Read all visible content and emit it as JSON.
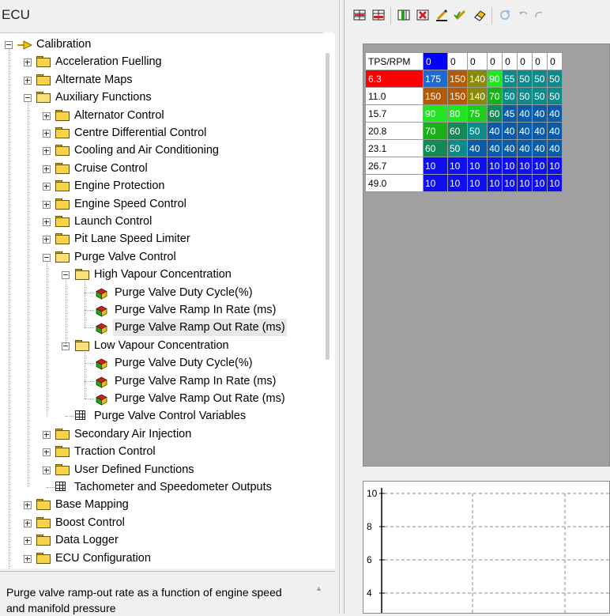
{
  "left_panel": {
    "title": "ECU",
    "tree": [
      {
        "label": "Calibration",
        "icon": "calibration-icon",
        "expander": "minus"
      },
      {
        "label": "Acceleration Fuelling",
        "icon": "folder-icon",
        "expander": "plus"
      },
      {
        "label": "Alternate Maps",
        "icon": "folder-icon",
        "expander": "plus"
      },
      {
        "label": "Auxiliary Functions",
        "icon": "folder-open-icon",
        "expander": "minus"
      },
      {
        "label": "Alternator Control",
        "icon": "folder-icon",
        "expander": "plus"
      },
      {
        "label": "Centre Differential Control",
        "icon": "folder-icon",
        "expander": "plus"
      },
      {
        "label": "Cooling and Air Conditioning",
        "icon": "folder-icon",
        "expander": "plus"
      },
      {
        "label": "Cruise Control",
        "icon": "folder-icon",
        "expander": "plus"
      },
      {
        "label": "Engine Protection",
        "icon": "folder-icon",
        "expander": "plus"
      },
      {
        "label": "Engine Speed Control",
        "icon": "folder-icon",
        "expander": "plus"
      },
      {
        "label": "Launch Control",
        "icon": "folder-icon",
        "expander": "plus"
      },
      {
        "label": "Pit Lane Speed Limiter",
        "icon": "folder-icon",
        "expander": "plus"
      },
      {
        "label": "Purge Valve Control",
        "icon": "folder-open-icon",
        "expander": "minus"
      },
      {
        "label": "High Vapour Concentration",
        "icon": "folder-open-icon",
        "expander": "minus"
      },
      {
        "label": "Purge Valve Duty Cycle(%)",
        "icon": "map-cube-icon"
      },
      {
        "label": "Purge Valve Ramp In Rate (ms)",
        "icon": "map-cube-icon"
      },
      {
        "label": "Purge Valve Ramp Out Rate (ms)",
        "icon": "map-cube-icon",
        "selected": true
      },
      {
        "label": "Low Vapour Concentration",
        "icon": "folder-open-icon",
        "expander": "minus"
      },
      {
        "label": "Purge Valve Duty Cycle(%)",
        "icon": "map-cube-icon"
      },
      {
        "label": "Purge Valve Ramp In Rate (ms)",
        "icon": "map-cube-icon"
      },
      {
        "label": "Purge Valve Ramp Out Rate (ms)",
        "icon": "map-cube-icon"
      },
      {
        "label": "Purge Valve Control Variables",
        "icon": "table-icon"
      },
      {
        "label": "Secondary Air Injection",
        "icon": "folder-icon",
        "expander": "plus"
      },
      {
        "label": "Traction Control",
        "icon": "folder-icon",
        "expander": "plus"
      },
      {
        "label": "User Defined Functions",
        "icon": "folder-icon",
        "expander": "plus"
      },
      {
        "label": "Tachometer and Speedometer Outputs",
        "icon": "table-icon"
      },
      {
        "label": "Base Mapping",
        "icon": "folder-icon",
        "expander": "plus"
      },
      {
        "label": "Boost Control",
        "icon": "folder-icon",
        "expander": "plus"
      },
      {
        "label": "Data Logger",
        "icon": "folder-icon",
        "expander": "plus"
      },
      {
        "label": "ECU Configuration",
        "icon": "folder-icon",
        "expander": "plus"
      }
    ],
    "description": "Purge valve ramp-out rate as a function of engine speed and manifold pressure"
  },
  "toolbar": {
    "buttons": [
      "insert-row-icon",
      "delete-row-icon",
      "insert-column-icon",
      "delete-column-icon",
      "edit-axis-icon",
      "edit-check-icon",
      "eraser-icon",
      "refresh-icon",
      "undo-icon",
      "redo-icon"
    ]
  },
  "map_table": {
    "corner_label": "TPS/RPM",
    "column_headers": [
      "0",
      "0",
      "0",
      "0",
      "0",
      "0",
      "0",
      "0"
    ],
    "active_column": 0,
    "rows": [
      {
        "header": "6.3",
        "highlighted": true,
        "values": [
          "175",
          "150",
          "140",
          "90",
          "55",
          "50",
          "50",
          "50"
        ]
      },
      {
        "header": "11.0",
        "values": [
          "150",
          "150",
          "140",
          "70",
          "50",
          "50",
          "50",
          "50"
        ]
      },
      {
        "header": "15.7",
        "values": [
          "90",
          "80",
          "75",
          "60",
          "45",
          "40",
          "40",
          "40"
        ]
      },
      {
        "header": "20.8",
        "values": [
          "70",
          "60",
          "50",
          "40",
          "40",
          "40",
          "40",
          "40"
        ]
      },
      {
        "header": "23.1",
        "values": [
          "60",
          "50",
          "40",
          "40",
          "40",
          "40",
          "40",
          "40"
        ]
      },
      {
        "header": "26.7",
        "values": [
          "10",
          "10",
          "10",
          "10",
          "10",
          "10",
          "10",
          "10"
        ]
      },
      {
        "header": "49.0",
        "values": [
          "10",
          "10",
          "10",
          "10",
          "10",
          "10",
          "10",
          "10"
        ]
      }
    ],
    "colors": {
      "header_highlight": "#ff0000",
      "active_header": "#0000ff"
    }
  },
  "graph": {
    "y_ticks": [
      "10",
      "8",
      "6",
      "4"
    ]
  }
}
